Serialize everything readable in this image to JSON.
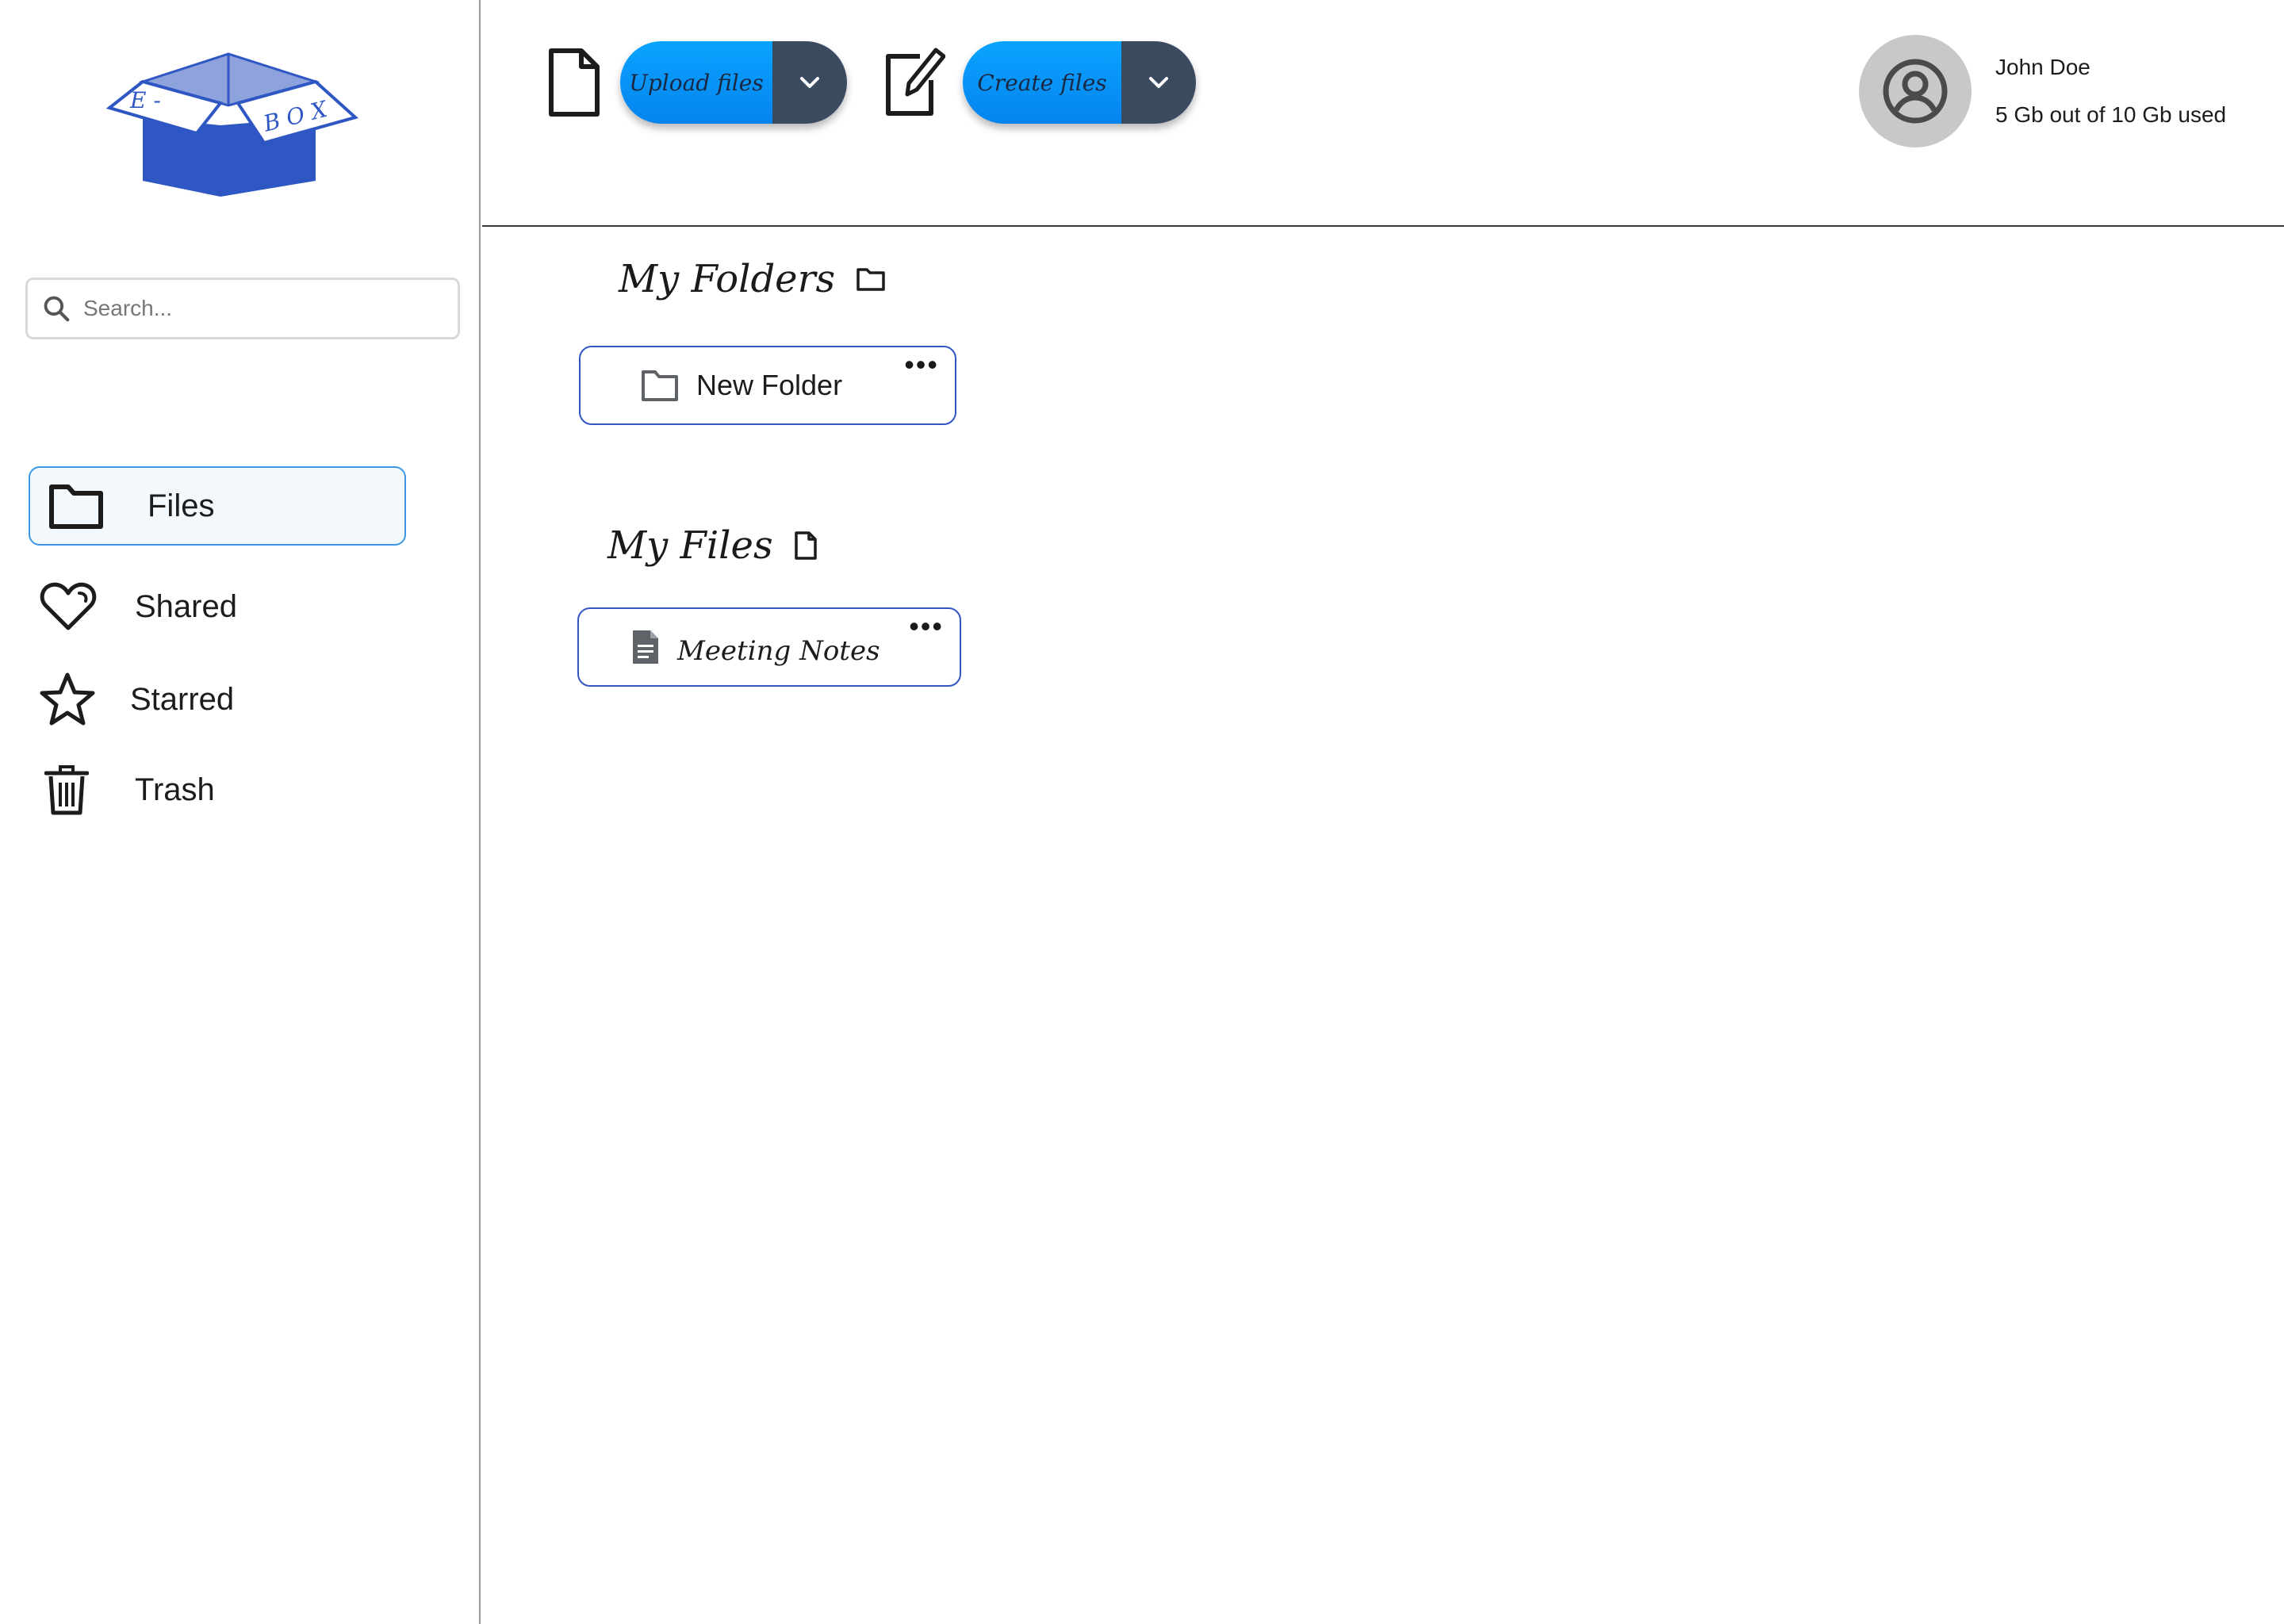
{
  "app": {
    "logo_left": "E - ",
    "logo_right": "B O X"
  },
  "sidebar": {
    "search": {
      "placeholder": "Search..."
    },
    "items": [
      {
        "label": "Files",
        "icon": "folder-icon",
        "active": true
      },
      {
        "label": "Shared",
        "icon": "heart-icon",
        "active": false
      },
      {
        "label": "Starred",
        "icon": "star-icon",
        "active": false
      },
      {
        "label": "Trash",
        "icon": "trash-icon",
        "active": false
      }
    ]
  },
  "toolbar": {
    "upload_label": "Upload files",
    "create_label": "Create files"
  },
  "user": {
    "name": "John Doe",
    "usage": "5 Gb out of 10 Gb used"
  },
  "main": {
    "folders_title": "My Folders",
    "files_title": "My Files",
    "folders": [
      {
        "name": "New Folder"
      }
    ],
    "files": [
      {
        "name": "Meeting Notes"
      }
    ],
    "menu_glyph": "•••"
  },
  "colors": {
    "accent_blue": "#0a94f5",
    "dropdown_dark": "#3a4a5f",
    "card_border": "#3256c4",
    "active_border": "#3b97e6",
    "logo_blue": "#2f57c4"
  }
}
